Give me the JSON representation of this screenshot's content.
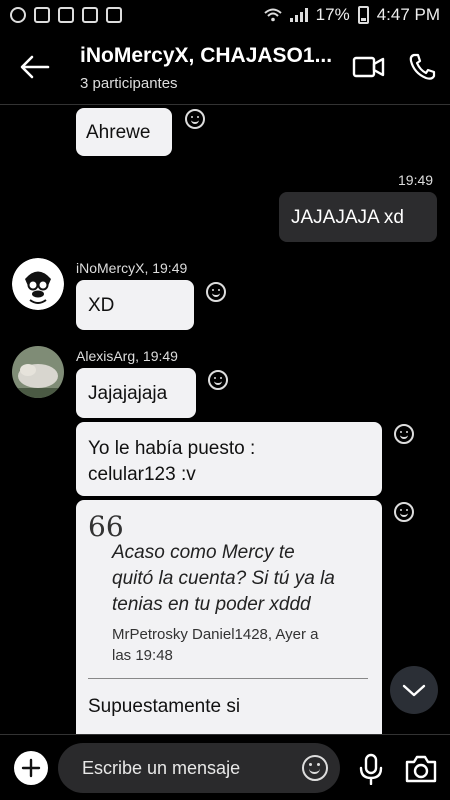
{
  "status_bar": {
    "battery": "17%",
    "time": "4:47 PM"
  },
  "header": {
    "title": "iNoMercyX, CHAJASO1...",
    "subtitle": "3 participantes"
  },
  "messages": {
    "m1": {
      "text": "Ahrewe"
    },
    "m2": {
      "time": "19:49",
      "text": "JAJAJAJA xd"
    },
    "m3": {
      "sender_line": "iNoMercyX, 19:49",
      "text": "XD"
    },
    "m4": {
      "sender_line": "AlexisArg, 19:49",
      "text": "Jajajajaja"
    },
    "m5": {
      "line1": "Yo le había puesto :",
      "line2": "celular123 :v"
    },
    "m6": {
      "quote_mark": "66",
      "quote_line1": "Acaso como Mercy te",
      "quote_line2": "quitó la cuenta? Si tú ya la",
      "quote_line3": "tenias en tu poder xddd",
      "quote_meta1": "MrPetrosky Daniel1428, Ayer a",
      "quote_meta2": "las 19:48",
      "reply": "Supuestamente si"
    }
  },
  "composer": {
    "placeholder": "Escribe un mensaje"
  },
  "icons": {
    "back": "arrow-left-icon",
    "video": "video-camera-icon",
    "phone": "phone-icon",
    "add": "plus-icon",
    "emoji": "smiley-icon",
    "mic": "microphone-icon",
    "camera": "camera-icon",
    "scroll": "chevron-down-icon"
  },
  "colors": {
    "background": "#000000",
    "incoming_bubble": "#f2f2f4",
    "outgoing_bubble": "#2c2c2e"
  }
}
